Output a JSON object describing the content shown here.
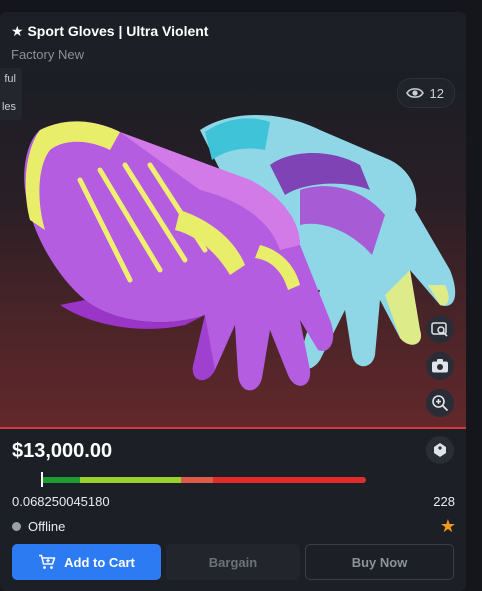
{
  "item": {
    "title": "★ Sport Gloves | Ultra Violent",
    "exterior": "Factory New",
    "price": "$13,000.00",
    "float": "0.068250045180",
    "float_fraction": 0.06825004518,
    "pattern": "228",
    "views": "12",
    "status": "Offline"
  },
  "side_tab": {
    "line1": "ful",
    "line2": "les"
  },
  "actions": {
    "add_to_cart": "Add to Cart",
    "bargain": "Bargain",
    "buy_now": "Buy Now"
  },
  "colors": {
    "accent": "#2c7bf2",
    "star": "#f29a1b",
    "wear_fn": "#1e9d2e",
    "wear_mw": "#9bcf2c",
    "wear_ft": "#e9c623",
    "wear_ww": "#e05a4c",
    "wear_bs": "#e22c2c"
  },
  "icons": {
    "views": "eye-icon",
    "inspect": "inspect-icon",
    "screenshot": "camera-icon",
    "zoom": "zoom-in-icon",
    "tag": "tag-icon",
    "cart": "cart-icon",
    "favorite": "star-icon"
  }
}
